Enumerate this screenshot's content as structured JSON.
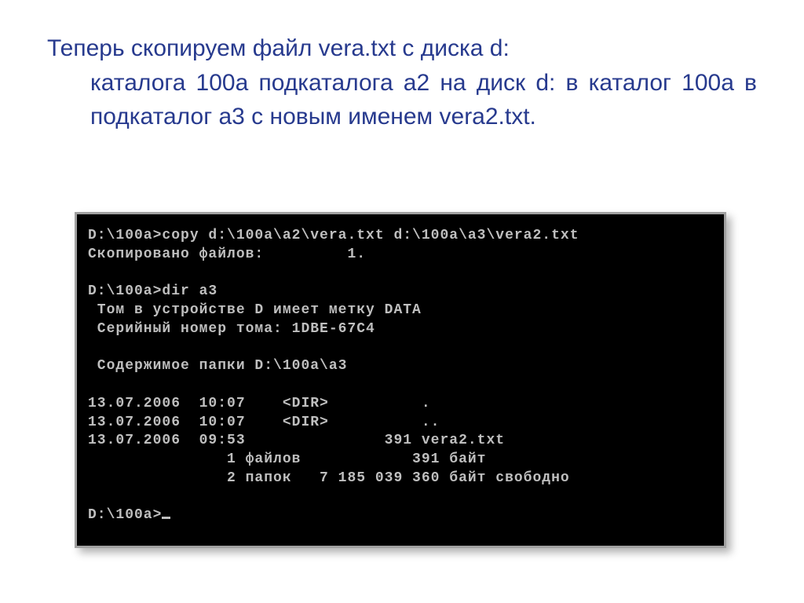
{
  "caption": {
    "line1": "Теперь скопируем файл vera.txt с диска d:",
    "rest": "каталога 100а подкаталога а2 на диск d: в каталог 100а в подкаталог а3 с новым именем vera2.txt."
  },
  "terminal": {
    "lines": [
      "D:\\100a>copy d:\\100a\\a2\\vera.txt d:\\100a\\a3\\vera2.txt",
      "Скопировано файлов:         1.",
      "",
      "D:\\100a>dir a3",
      " Том в устройстве D имеет метку DATA",
      " Серийный номер тома: 1DBE-67C4",
      "",
      " Содержимое папки D:\\100a\\a3",
      "",
      "13.07.2006  10:07    <DIR>          .",
      "13.07.2006  10:07    <DIR>          ..",
      "13.07.2006  09:53               391 vera2.txt",
      "               1 файлов            391 байт",
      "               2 папок   7 185 039 360 байт свободно",
      "",
      "D:\\100a>"
    ]
  }
}
